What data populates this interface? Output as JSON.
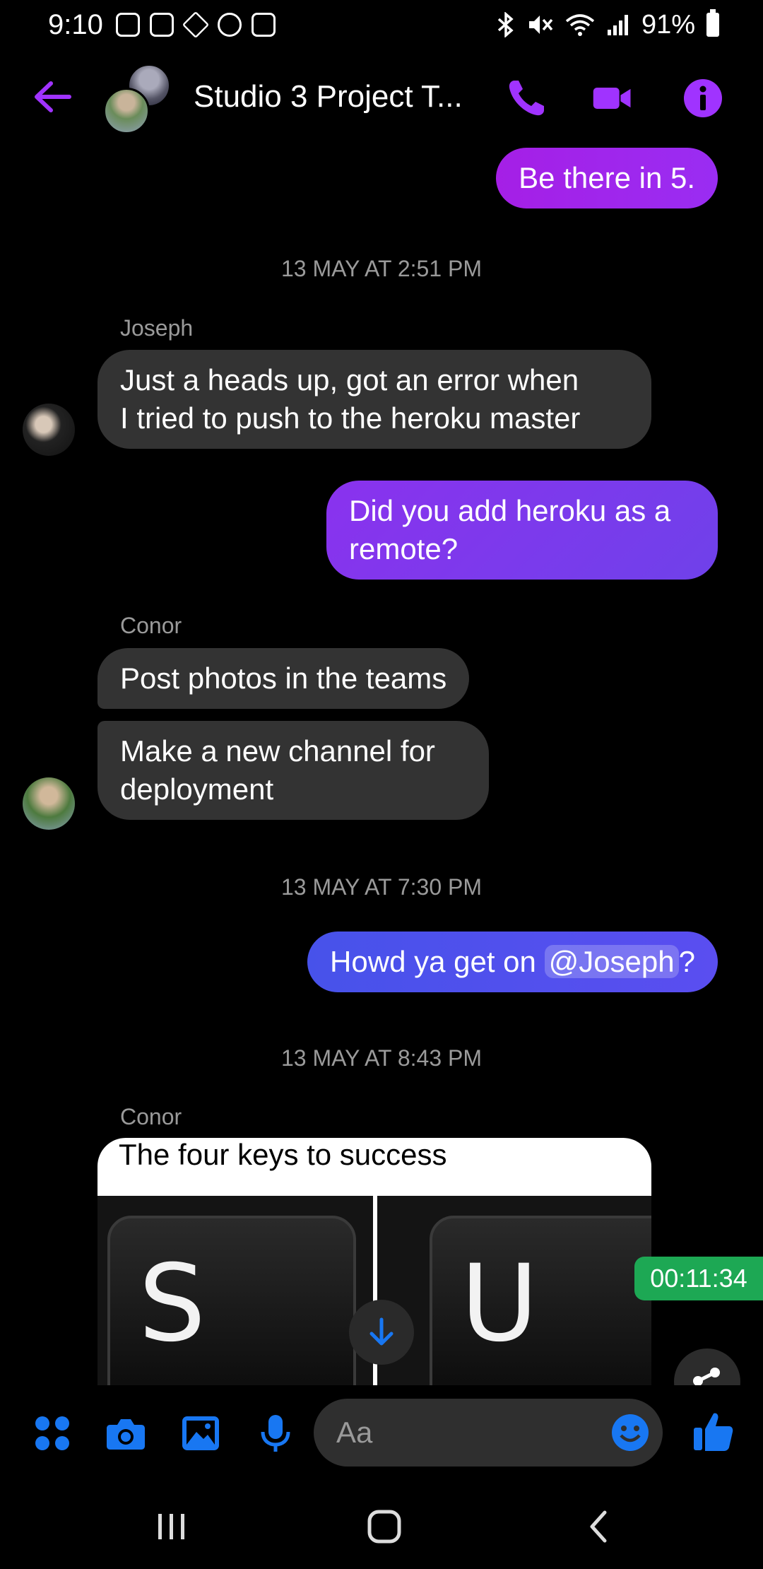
{
  "status_bar": {
    "time": "9:10",
    "battery": "91%"
  },
  "header": {
    "title": "Studio 3 Project T..."
  },
  "messages": {
    "m1": {
      "text": "Be there in 5."
    },
    "ts1": "13 MAY AT 2:51 PM",
    "joseph_name": "Joseph",
    "m2": {
      "line1": "Just a heads up, got an error when",
      "line2": "I tried to push to the heroku master"
    },
    "m3": {
      "line1": "Did you add heroku as a",
      "line2": "remote?"
    },
    "conor_name": "Conor",
    "m4": {
      "text": "Post photos in the teams"
    },
    "m5": {
      "line1": "Make a new channel for",
      "line2": "deployment"
    },
    "ts2": "13 MAY AT 7:30 PM",
    "m6": {
      "prefix": "Howd ya get on ",
      "mention": "@Joseph",
      "suffix": "?"
    },
    "ts3": "13 MAY AT 8:43 PM",
    "conor_name_2": "Conor",
    "image": {
      "caption": "The four keys to success",
      "key1": "S",
      "key2": "U"
    }
  },
  "timer": "00:11:34",
  "composer": {
    "placeholder": "Aa"
  },
  "colors": {
    "accent": "#a033ff",
    "blue": "#1877f2",
    "bubble_in": "#333333",
    "timer": "#1da854"
  }
}
